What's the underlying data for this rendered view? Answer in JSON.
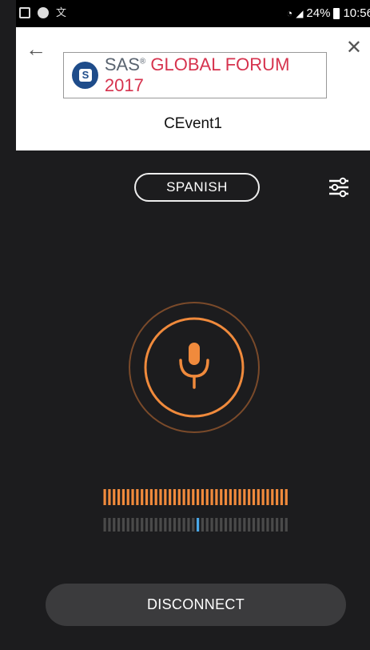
{
  "status_bar": {
    "battery": "24%",
    "time": "10:56"
  },
  "header": {
    "logo": {
      "brand": "SAS",
      "name": "GLOBAL FORUM 2017"
    },
    "event_name": "CEvent1"
  },
  "controls": {
    "language": "SPANISH",
    "disconnect_label": "DISCONNECT"
  },
  "audio": {
    "input_level": 1.0,
    "balance_position": 0.5
  },
  "colors": {
    "accent": "#f08a3c",
    "indicator": "#4aa8e8",
    "background": "#1c1c1e"
  }
}
